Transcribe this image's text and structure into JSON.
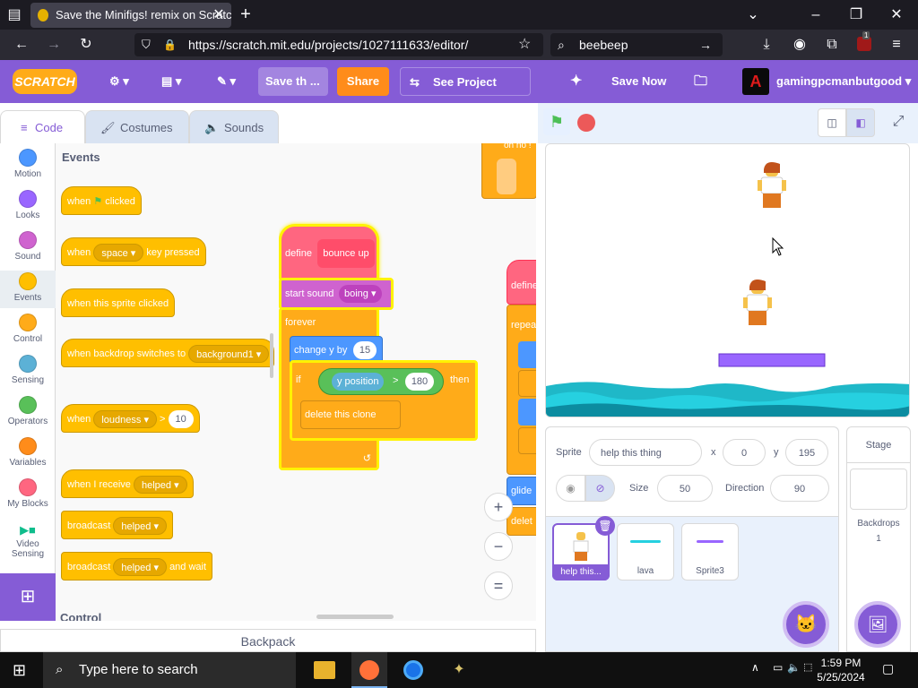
{
  "browser": {
    "tab_title": "Save the Minifigs! remix on Scratch",
    "url": "https://scratch.mit.edu/projects/1027111633/editor/",
    "search_text": "beebeep",
    "extension_badge": "1"
  },
  "menubar": {
    "logo": "SCRATCH",
    "title_field": "Save th ...",
    "share_label": "Share",
    "see_project_label": "See Project Page",
    "save_now_label": "Save Now",
    "username": "gamingpcmanbutgood",
    "accent_color": "#855cd6",
    "share_color": "#ff8c1a"
  },
  "tabs": {
    "code": "Code",
    "costumes": "Costumes",
    "sounds": "Sounds"
  },
  "categories": [
    {
      "label": "Motion",
      "color": "#4c97ff"
    },
    {
      "label": "Looks",
      "color": "#9966ff"
    },
    {
      "label": "Sound",
      "color": "#cf63cf"
    },
    {
      "label": "Events",
      "color": "#ffbf00"
    },
    {
      "label": "Control",
      "color": "#ffab19"
    },
    {
      "label": "Sensing",
      "color": "#5cb1d6"
    },
    {
      "label": "Operators",
      "color": "#59c059"
    },
    {
      "label": "Variables",
      "color": "#ff8c1a"
    },
    {
      "label": "My Blocks",
      "color": "#ff6680"
    },
    {
      "label": "Video Sensing",
      "color": "#0fbd8c"
    }
  ],
  "palette": {
    "section_title": "Events",
    "next_section": "Control",
    "blocks": {
      "when_flag_1": "when",
      "when_flag_2": "clicked",
      "key_1": "when",
      "key_dropdown": "space",
      "key_2": "key pressed",
      "sprite_clicked": "when this sprite clicked",
      "backdrop_1": "when backdrop switches to",
      "backdrop_dropdown": "background1",
      "loudness_1": "when",
      "loudness_dropdown": "loudness",
      "loudness_op": ">",
      "loudness_value": "10",
      "receive_1": "when I receive",
      "receive_dropdown": "helped",
      "broadcast_1": "broadcast",
      "broadcast_dropdown": "helped",
      "broadcast_wait_1": "broadcast",
      "broadcast_wait_dropdown": "helped",
      "broadcast_wait_2": "and wait"
    }
  },
  "script": {
    "define_label": "define",
    "define_name": "bounce up",
    "start_sound": "start sound",
    "sound_name": "boing",
    "forever": "forever",
    "change_y": "change y by",
    "change_y_value": "15",
    "if_label": "if",
    "y_position": "y position",
    "gt": ">",
    "threshold": "180",
    "then": "then",
    "delete_clone": "delete this clone",
    "partial_top": "oh no !",
    "partial_define": "define",
    "partial_repeat": "repea",
    "partial_glide": "glide",
    "partial_delete": "delet"
  },
  "zoom": {
    "in": "+",
    "out": "−",
    "reset": "="
  },
  "sprite_info": {
    "sprite_label": "Sprite",
    "sprite_name": "help this thing",
    "x_label": "x",
    "x_value": "0",
    "y_label": "y",
    "y_value": "195",
    "size_label": "Size",
    "size_value": "50",
    "direction_label": "Direction",
    "direction_value": "90"
  },
  "sprites": [
    {
      "name": "help this...",
      "selected": true
    },
    {
      "name": "lava",
      "selected": false
    },
    {
      "name": "Sprite3",
      "selected": false
    }
  ],
  "stage_panel": {
    "title": "Stage",
    "backdrops_label": "Backdrops",
    "backdrops_count": "1"
  },
  "backpack": "Backpack",
  "taskbar": {
    "search_placeholder": "Type here to search",
    "time": "1:59 PM",
    "date": "5/25/2024"
  }
}
